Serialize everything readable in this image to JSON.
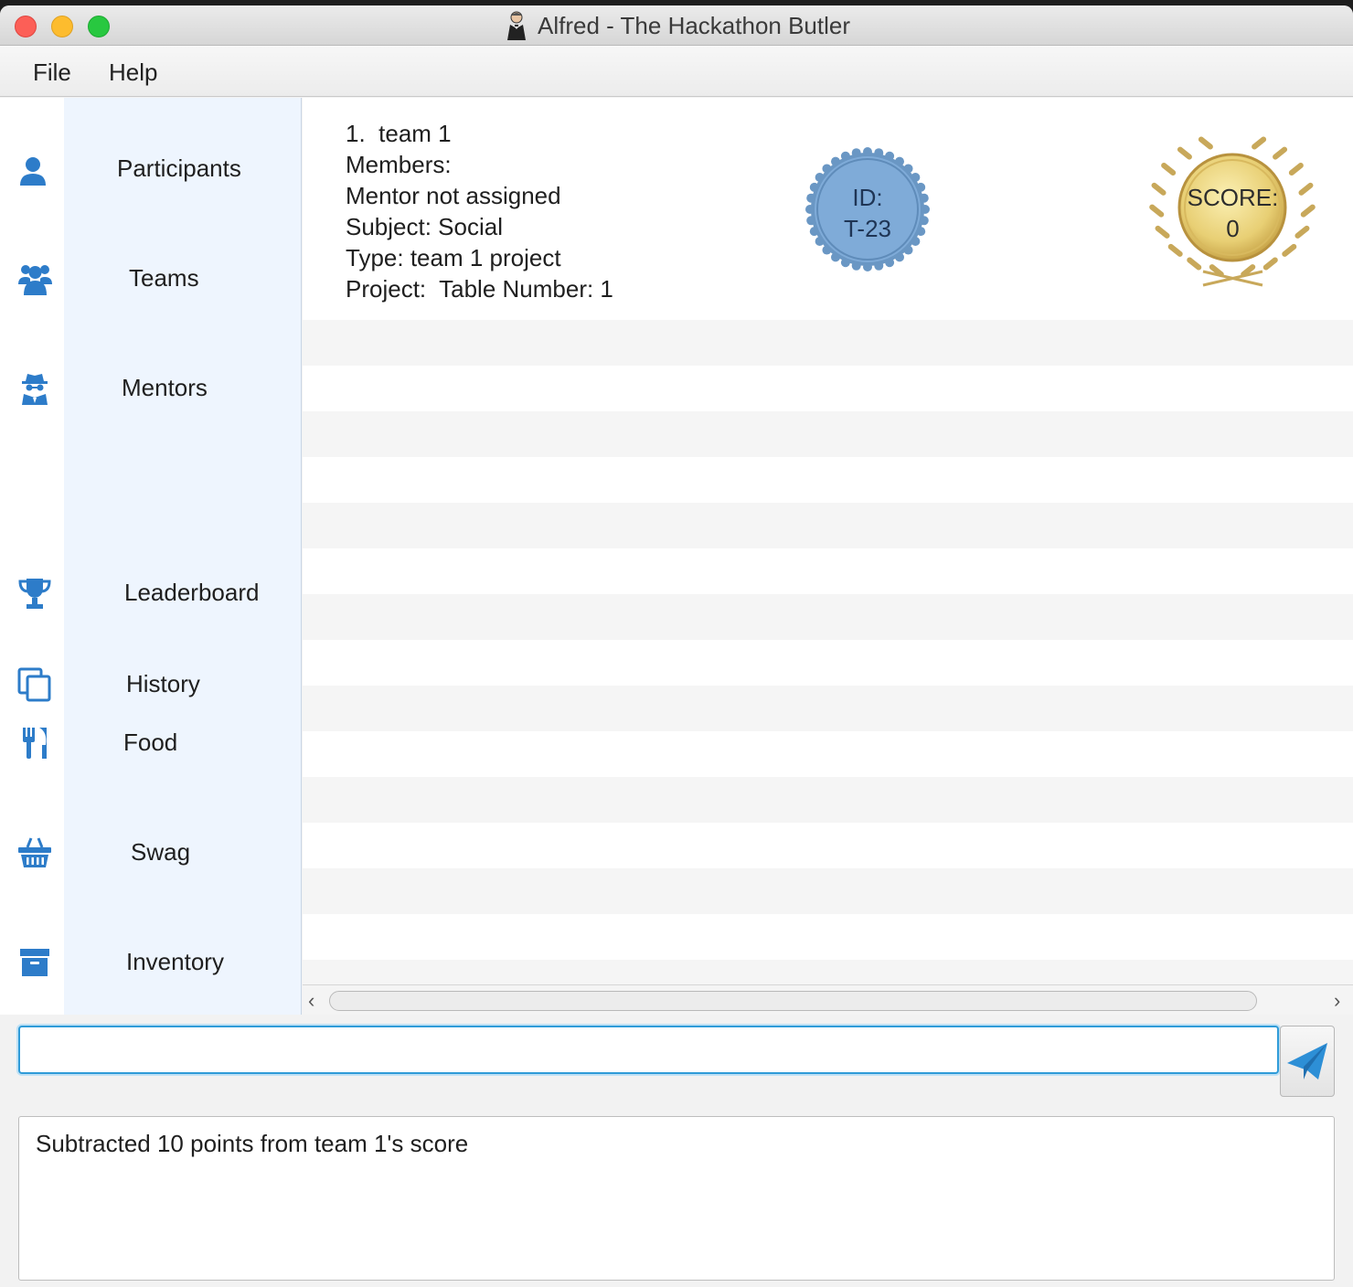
{
  "window": {
    "title": "Alfred - The Hackathon Butler"
  },
  "menubar": {
    "items": [
      "File",
      "Help"
    ]
  },
  "sidebar": {
    "items": [
      {
        "label": "Participants",
        "icon": "user-icon"
      },
      {
        "label": "Teams",
        "icon": "users-icon"
      },
      {
        "label": "Mentors",
        "icon": "mentor-icon"
      },
      {
        "label": "Leaderboard",
        "icon": "trophy-icon"
      },
      {
        "label": "History",
        "icon": "copy-icon"
      },
      {
        "label": "Food",
        "icon": "utensils-icon"
      },
      {
        "label": "Swag",
        "icon": "basket-icon"
      },
      {
        "label": "Inventory",
        "icon": "archive-icon"
      }
    ]
  },
  "team_card": {
    "index_label": "1.  team 1",
    "members": "Members:",
    "mentor": "Mentor not assigned",
    "subject": "Subject: Social",
    "type": "Type: team 1 project",
    "project": "Project:  Table Number: 1",
    "id_label": "ID:",
    "id_value": "T-23",
    "score_label": "SCORE:",
    "score_value": "0"
  },
  "command": {
    "input_value": "",
    "send_icon": "paper-plane-icon"
  },
  "result": {
    "text": "Subtracted 10 points from team 1's score"
  },
  "colors": {
    "sidebar_bg": "#eef5fe",
    "icon_blue": "#2d7cc9",
    "input_border": "#2f9bd8",
    "id_badge": "#7aa8d6",
    "score_gold": "#e8cf74"
  }
}
